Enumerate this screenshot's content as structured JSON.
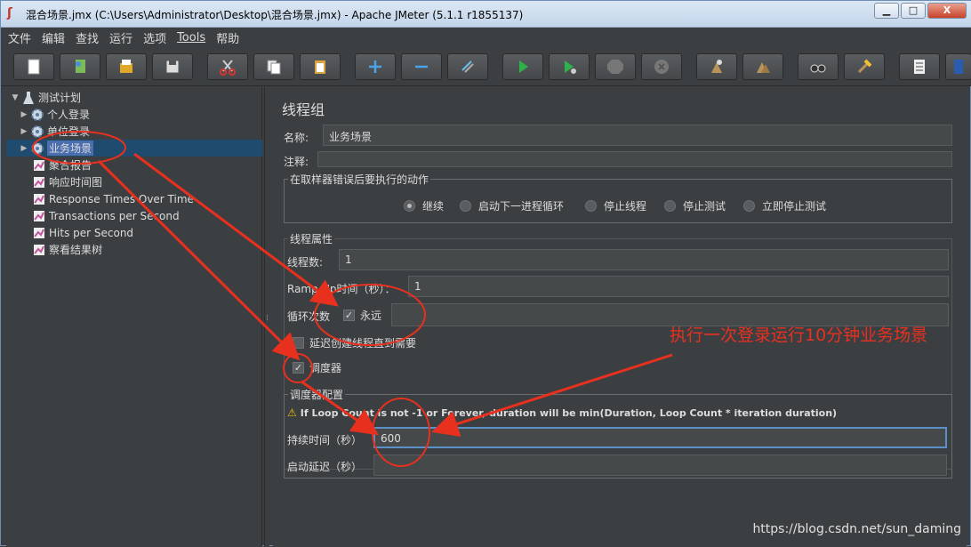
{
  "window": {
    "title": "混合场景.jmx (C:\\Users\\Administrator\\Desktop\\混合场景.jmx) - Apache JMeter (5.1.1 r1855137)",
    "minimize": "▁",
    "maximize": "□",
    "close": "X"
  },
  "menu": [
    "文件",
    "编辑",
    "查找",
    "运行",
    "选项",
    "Tools",
    "帮助"
  ],
  "toolbar_icons": [
    "new-icon",
    "templates-icon",
    "open-icon",
    "save-icon",
    "cut-icon",
    "copy-icon",
    "paste-icon",
    "expand-icon",
    "collapse-icon",
    "toggle-icon",
    "start-icon",
    "start-no-pause-icon",
    "stop-icon",
    "shutdown-icon",
    "clear-icon",
    "clear-all-icon",
    "search-icon",
    "reset-search-icon",
    "function-helper-icon",
    "help-icon"
  ],
  "tree": {
    "root": "测试计划",
    "items": [
      {
        "label": "个人登录",
        "type": "thread-group"
      },
      {
        "label": "单位登录",
        "type": "thread-group"
      },
      {
        "label": "业务场景",
        "type": "thread-group",
        "selected": true
      },
      {
        "label": "聚合报告",
        "type": "listener"
      },
      {
        "label": "响应时间图",
        "type": "listener"
      },
      {
        "label": "Response Times Over Time",
        "type": "listener"
      },
      {
        "label": "Transactions per Second",
        "type": "listener"
      },
      {
        "label": "Hits per Second",
        "type": "listener"
      },
      {
        "label": "察看结果树",
        "type": "listener"
      }
    ]
  },
  "panel": {
    "title": "线程组",
    "name_label": "名称:",
    "name_value": "业务场景",
    "comment_label": "注释:",
    "comment_value": "",
    "error_action": {
      "title": "在取样器错误后要执行的动作",
      "options": [
        "继续",
        "启动下一进程循环",
        "停止线程",
        "停止测试",
        "立即停止测试"
      ],
      "selected": "继续"
    },
    "thread_props": {
      "title": "线程属性",
      "threads_label": "线程数:",
      "threads_value": "1",
      "rampup_label": "Ramp-Up时间（秒）：",
      "rampup_value": "1",
      "loop_label": "循环次数",
      "forever_label": "永远",
      "forever_checked": true,
      "loop_value": "",
      "delay_label": "延迟创建线程直到需要",
      "delay_checked": false,
      "scheduler_label": "调度器",
      "scheduler_checked": true
    },
    "scheduler": {
      "title": "调度器配置",
      "warning": "If Loop Count is not -1 or Forever, duration will be min(Duration, Loop Count * iteration duration)",
      "duration_label": "持续时间（秒）",
      "duration_value": "600",
      "delay_label": "启动延迟（秒）",
      "delay_value": ""
    }
  },
  "annotation": "执行一次登录运行10分钟业务场景",
  "watermark": "https://blog.csdn.net/sun_daming",
  "colors": {
    "annotation": "#e8301f",
    "background": "#3c3f41",
    "selection": "#4b6eaf"
  }
}
